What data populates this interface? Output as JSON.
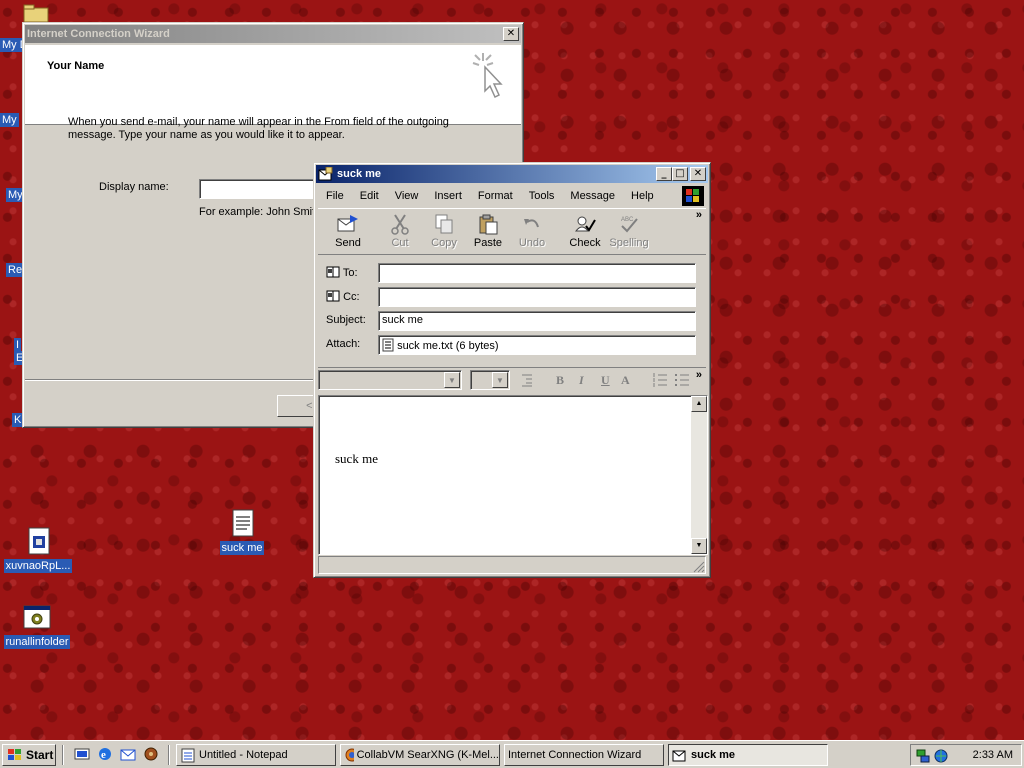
{
  "desktop": {
    "icons": [
      {
        "label": "xuvnaoRpL..."
      },
      {
        "label": "suck me"
      },
      {
        "label": "runallinfolder"
      }
    ],
    "edge_labels": [
      "My D",
      "My",
      "My",
      "Re",
      "I",
      "E",
      "K"
    ]
  },
  "wizard": {
    "title": "Internet Connection Wizard",
    "heading": "Your Name",
    "description": "When you send e-mail, your name will appear in the From field of the outgoing message. Type your name as you would like it to appear.",
    "display_name_label": "Display name:",
    "display_name_value": "",
    "example": "For example: John Smith",
    "back_button": "< B"
  },
  "message_window": {
    "title": "suck me",
    "menu": [
      "File",
      "Edit",
      "View",
      "Insert",
      "Format",
      "Tools",
      "Message",
      "Help"
    ],
    "toolbar": [
      {
        "label": "Send",
        "icon": "send-icon",
        "enabled": true
      },
      {
        "label": "Cut",
        "icon": "cut-icon",
        "enabled": false
      },
      {
        "label": "Copy",
        "icon": "copy-icon",
        "enabled": false
      },
      {
        "label": "Paste",
        "icon": "paste-icon",
        "enabled": true
      },
      {
        "label": "Undo",
        "icon": "undo-icon",
        "enabled": false
      },
      {
        "label": "Check",
        "icon": "check-names-icon",
        "enabled": true
      },
      {
        "label": "Spelling",
        "icon": "spelling-icon",
        "enabled": false
      }
    ],
    "headers": {
      "to_label": "To:",
      "to_value": "",
      "cc_label": "Cc:",
      "cc_value": "",
      "subject_label": "Subject:",
      "subject_value": "suck me",
      "attach_label": "Attach:",
      "attach_value": "suck me.txt (6 bytes)"
    },
    "body_text": "suck me"
  },
  "taskbar": {
    "start_label": "Start",
    "tasks": [
      {
        "label": "Untitled - Notepad",
        "active": false
      },
      {
        "label": "CollabVM SearXNG (K-Mel...",
        "active": false
      },
      {
        "label": "Internet Connection Wizard",
        "active": false
      },
      {
        "label": "suck me",
        "active": true
      }
    ],
    "clock": "2:33 AM"
  },
  "colors": {
    "desktop_bg": "#9b1414",
    "title_active": "#0a246a",
    "selection": "#2a5bb4",
    "face": "#d4d0c8"
  }
}
